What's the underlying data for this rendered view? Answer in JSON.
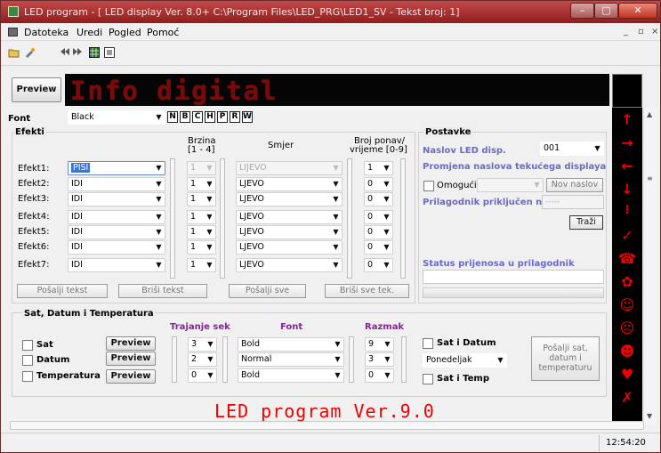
{
  "window": {
    "title": "LED program - [ LED display Ver. 8.0+  C:\\Program Files\\LED_PRG\\LED1_SV  - Tekst broj: 1]",
    "min": "–",
    "max": "▢",
    "close": "✕"
  },
  "menu": [
    "Datoteka",
    "Uredi",
    "Pogled",
    "Pomoć"
  ],
  "mdi": {
    "min": "_",
    "restore": "▫",
    "close": "×"
  },
  "preview_label": "Preview",
  "led_text": "Info digital",
  "font_label": "Font",
  "font_value": "Black",
  "format_buttons": [
    "N",
    "B",
    "C",
    "H",
    "P",
    "R",
    "W"
  ],
  "efekti": {
    "title": "Efekti",
    "col_brzina": "Brzina",
    "col_brzina_range": "[1 - 4]",
    "col_smjer": "Smjer",
    "col_broj": "Broj ponav/",
    "col_broj_range": "vrijeme [0-9]",
    "rows": [
      {
        "label": "Efekt1:",
        "effect": "PISI",
        "speed": "1",
        "dir": "LIJEVO",
        "count": "1"
      },
      {
        "label": "Efekt2:",
        "effect": "IDI",
        "speed": "1",
        "dir": "LJEVO",
        "count": "0"
      },
      {
        "label": "Efekt3:",
        "effect": "IDI",
        "speed": "1",
        "dir": "LJEVO",
        "count": "0"
      },
      {
        "label": "Efekt4:",
        "effect": "IDI",
        "speed": "1",
        "dir": "LJEVO",
        "count": "0"
      },
      {
        "label": "Efekt5:",
        "effect": "IDI",
        "speed": "1",
        "dir": "LJEVO",
        "count": "0"
      },
      {
        "label": "Efekt6:",
        "effect": "IDI",
        "speed": "1",
        "dir": "LJEVO",
        "count": "0"
      },
      {
        "label": "Efekt7:",
        "effect": "IDI",
        "speed": "1",
        "dir": "LJEVO",
        "count": "0"
      }
    ],
    "buttons": [
      "Pošalji tekst",
      "Briši tekst",
      "Pošalji sve",
      "Briši sve tek."
    ]
  },
  "postavke": {
    "title": "Postavke",
    "naslov_label": "Naslov LED disp.",
    "naslov_value": "001",
    "promjena_label": "Promjena naslova tekućega displaya",
    "omoguci_label": "Omogući",
    "nov_naslov": "Nov naslov",
    "prilagodnik_label": "Prilagodnik priključen na",
    "prilagodnik_value": "-----",
    "trazi": "Traži",
    "status_label": "Status prijenosa u prilagodnik"
  },
  "sat": {
    "title": "Sat, Datum i Temperatura",
    "col_trajanje": "Trajanje sek",
    "col_font": "Font",
    "col_razmak": "Razmak",
    "rows": [
      {
        "label": "Sat",
        "preview": "Preview",
        "duration": "3",
        "font": "Bold",
        "spacing": "9"
      },
      {
        "label": "Datum",
        "preview": "Preview",
        "duration": "2",
        "font": "Normal",
        "spacing": "3"
      },
      {
        "label": "Temperatura",
        "preview": "Preview",
        "duration": "0",
        "font": "Bold",
        "spacing": "0"
      }
    ],
    "sat_i_datum": "Sat i Datum",
    "day_value": "Ponedeljak",
    "sat_i_temp": "Sat i Temp",
    "send_line1": "Pošalji sat,",
    "send_line2": "datum i",
    "send_line3": "temperaturu"
  },
  "banner": "LED program Ver.9.0",
  "status_time": "12:54:20",
  "colors": {
    "title_bar": "#a8302e",
    "led_off": "#7a0a0a",
    "led_on": "#ee0000",
    "group_heading": "#8a1f9c",
    "settings_label": "#6a6ac8"
  }
}
